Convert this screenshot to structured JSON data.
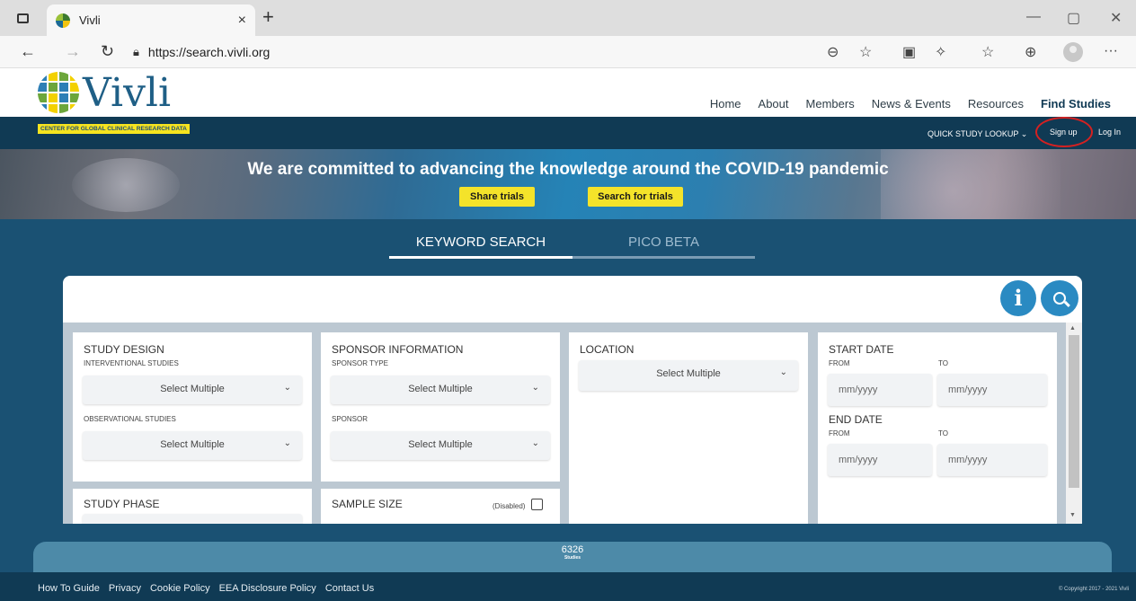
{
  "browser": {
    "tab_title": "Vivli",
    "tab_close": "×",
    "new_tab": "+",
    "url": "https://search.vivli.org",
    "window_controls": {
      "minimize": "—",
      "restore": "▢",
      "close": "✕"
    },
    "nav_icons": [
      "back-icon",
      "forward-icon",
      "refresh-icon"
    ],
    "toolbar_icons": [
      "zoom-out-icon",
      "read-aloud-icon",
      "extension-icon",
      "extensions-icon",
      "favorites-icon",
      "collections-icon",
      "profile-icon",
      "more-icon"
    ],
    "more_label": "···"
  },
  "site": {
    "logo_text": "Vivli",
    "tagline": "CENTER FOR GLOBAL CLINICAL RESEARCH DATA",
    "nav": [
      "Home",
      "About",
      "Members",
      "News & Events",
      "Resources",
      "Find Studies"
    ],
    "active_nav": "Find Studies",
    "quick_lookup": "QUICK STUDY LOOKUP ⌄",
    "signup": "Sign up",
    "login": "Log In"
  },
  "banner": {
    "title": "We are committed to advancing the knowledge around the COVID-19 pandemic",
    "share_button": "Share trials",
    "search_button": "Search for trials"
  },
  "search_tabs": [
    {
      "label": "KEYWORD SEARCH",
      "active": true
    },
    {
      "label": "PICO BETA",
      "active": false
    }
  ],
  "search": {
    "info_label": "i"
  },
  "filters": {
    "study_design": {
      "title": "STUDY DESIGN",
      "interventional_label": "INTERVENTIONAL STUDIES",
      "interventional_value": "Select Multiple",
      "observational_label": "OBSERVATIONAL STUDIES",
      "observational_value": "Select Multiple"
    },
    "sponsor": {
      "title": "SPONSOR INFORMATION",
      "type_label": "SPONSOR TYPE",
      "type_value": "Select Multiple",
      "sponsor_label": "SPONSOR",
      "sponsor_value": "Select Multiple"
    },
    "location": {
      "title": "LOCATION",
      "value": "Select Multiple"
    },
    "dates": {
      "start_title": "START DATE",
      "end_title": "END DATE",
      "from_label": "FROM",
      "to_label": "TO",
      "placeholder": "mm/yyyy"
    },
    "study_phase": {
      "title": "STUDY PHASE"
    },
    "sample_size": {
      "title": "SAMPLE SIZE",
      "disabled_label": "(Disabled)"
    },
    "chevron": "⌄"
  },
  "results": {
    "count": "6326",
    "label": "Studies"
  },
  "footer": {
    "links": [
      "How To Guide",
      "Privacy",
      "Cookie Policy",
      "EEA Disclosure Policy",
      "Contact Us"
    ],
    "copyright": "© Copyright 2017 - 2021 Vivli"
  },
  "colors": {
    "header_dark": "#103a54",
    "page_bg": "#1a5173",
    "accent_yellow": "#f4e32a",
    "button_blue": "#2a8ac2",
    "signup_highlight": "#d52121"
  }
}
